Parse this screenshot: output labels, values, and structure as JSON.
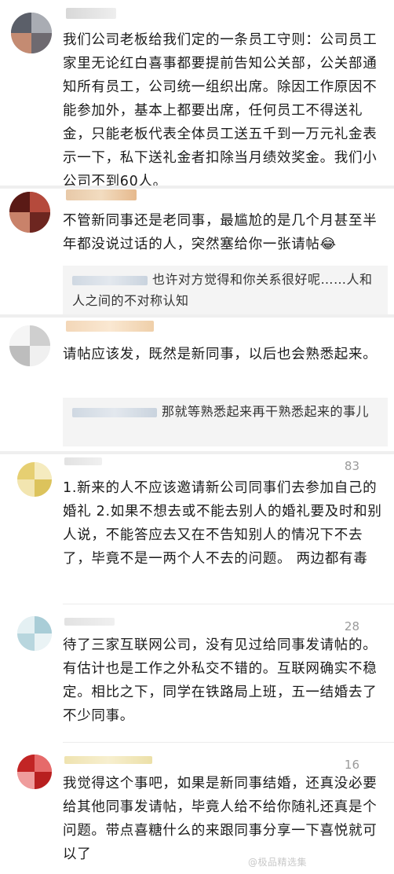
{
  "comments": [
    {
      "text": "我们公司老板给我们定的一条员工守则：公司员工家里无论红白喜事都要提前告知公关部，公关部通知所有员工，公司统一组织出席。除因工作原因不能参加外，基本上都要出席，任何员工不得送礼金，只能老板代表全体员工送五千到一万元礼金表示一下，私下送礼金者扣除当月绩效奖金。我们小公司不到60人。"
    },
    {
      "text": "不管新同事还是老同事，最尴尬的是几个月甚至半年都没说过话的人，突然塞给你一张请帖😂",
      "reply": "也许对方觉得和你关系很好呢……人和人之间的不对称认知"
    },
    {
      "text": "请帖应该发，既然是新同事，以后也会熟悉起来。",
      "reply": "那就等熟悉起来再干熟悉起来的事儿"
    },
    {
      "likes": "83",
      "text": "1.新来的人不应该邀请新公司同事们去参加自己的婚礼 2.如果不想去或不能去别人的婚礼要及时和别人说，不能答应去又在不告知别人的情况下不去了，毕竟不是一两个人不去的问题。   两边都有毒"
    },
    {
      "likes": "28",
      "text": "待了三家互联网公司，没有见过给同事发请帖的。有估计也是工作之外私交不错的。互联网确实不稳定。相比之下，同学在铁路局上班，五一结婚去了不少同事。"
    },
    {
      "likes": "16",
      "text": "我觉得这个事吧，如果是新同事结婚，还真没必要给其他同事发请帖，毕竟人给不给你随礼还真是个问题。带点喜糖什么的来跟同事分享一下喜悦就可以了"
    }
  ],
  "watermark": "@极品精选集"
}
